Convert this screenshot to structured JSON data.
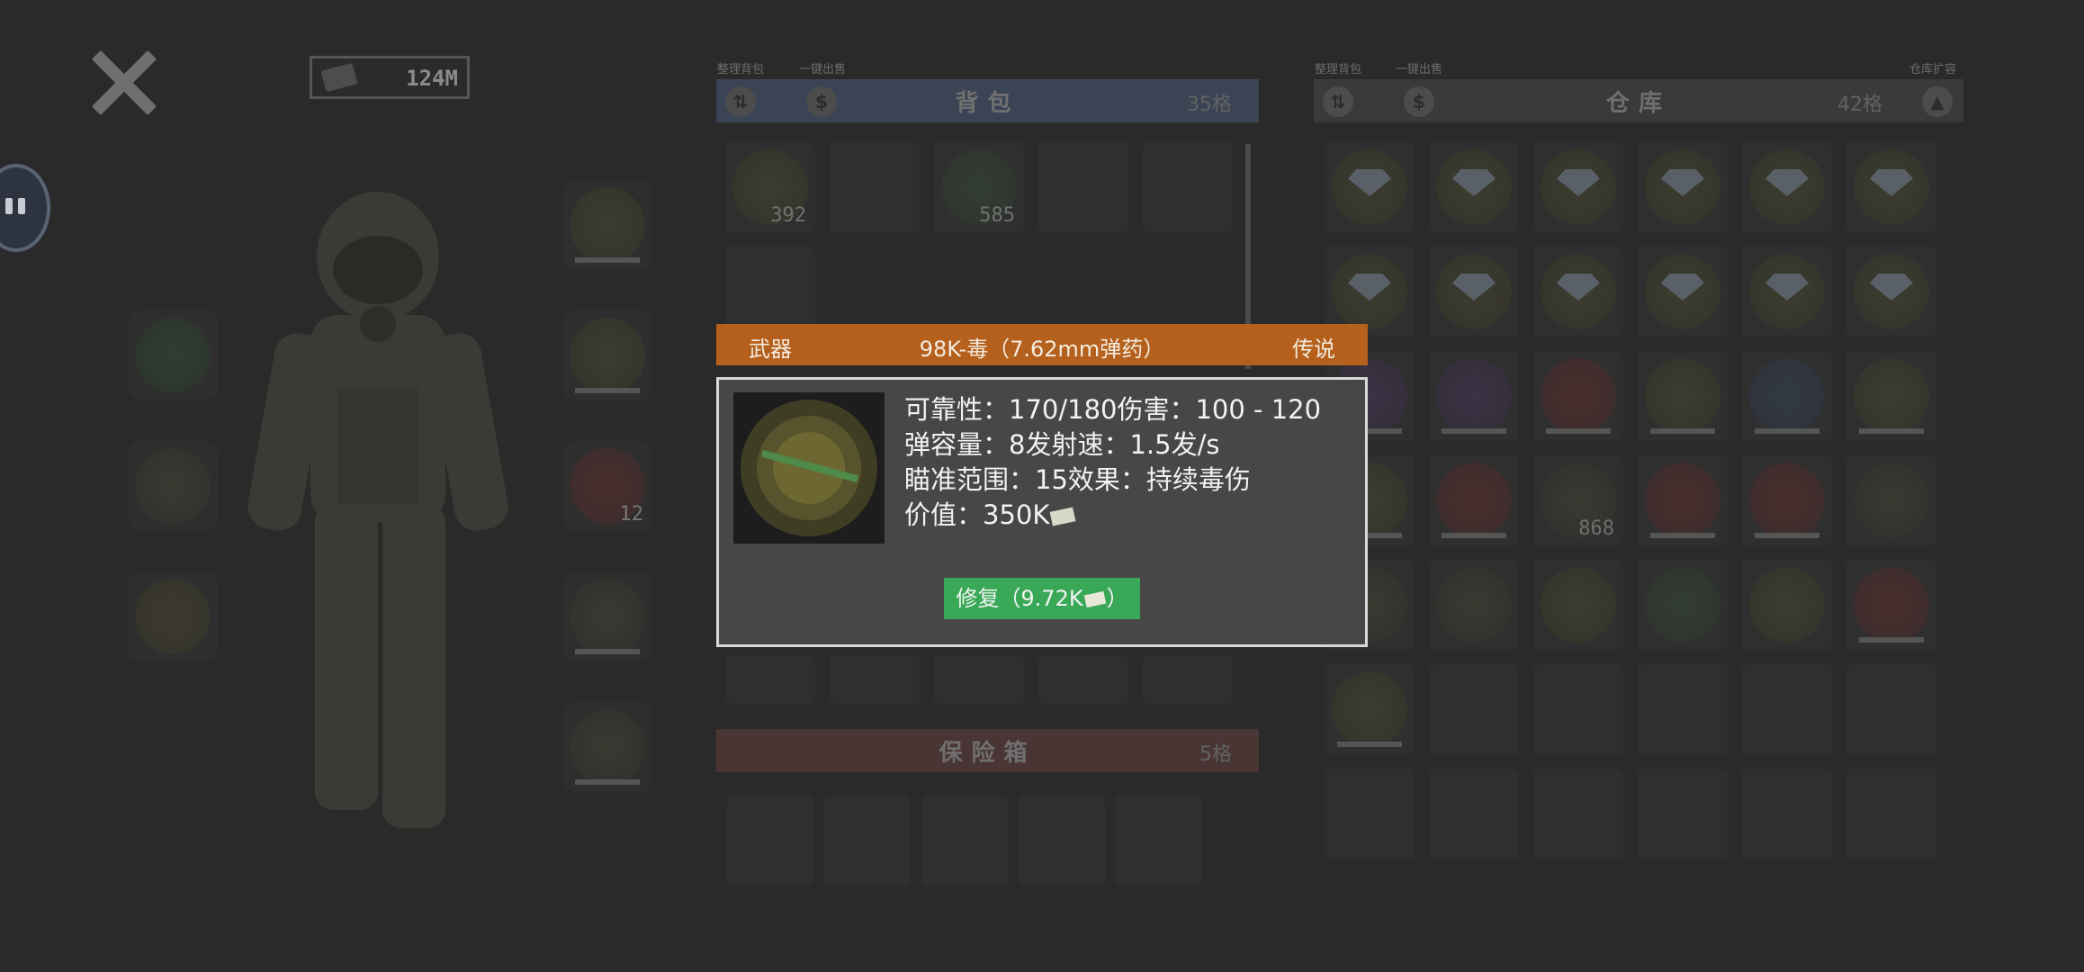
{
  "money": {
    "amount": "124M"
  },
  "left_slots_counts": {
    "weapon3": "12"
  },
  "backpack": {
    "sort_label": "整理背包",
    "sell_label": "一键出售",
    "title": "背包",
    "capacity": "35格",
    "item_counts": [
      "392",
      "585"
    ]
  },
  "safe_box": {
    "title": "保险箱",
    "capacity": "5格"
  },
  "warehouse": {
    "sort_label": "整理背包",
    "sell_label": "一键出售",
    "expand_label": "仓库扩容",
    "title": "仓库",
    "capacity": "42格",
    "item_counts": {
      "ammo_box": "868"
    }
  },
  "dialog": {
    "category": "武器",
    "name": "98K-毒（7.62mm弹药）",
    "rarity": "传说",
    "stats": [
      "可靠性：170/180伤害：100 - 120",
      "弹容量：8发射速：1.5发/s",
      "瞄准范围：15效果：持续毒伤",
      "价值：350K"
    ],
    "repair_label": "修复（9.72K",
    "repair_suffix": "）"
  },
  "colors": {
    "rarity_orange": "#b5601c",
    "repair_green": "#3aa957"
  }
}
